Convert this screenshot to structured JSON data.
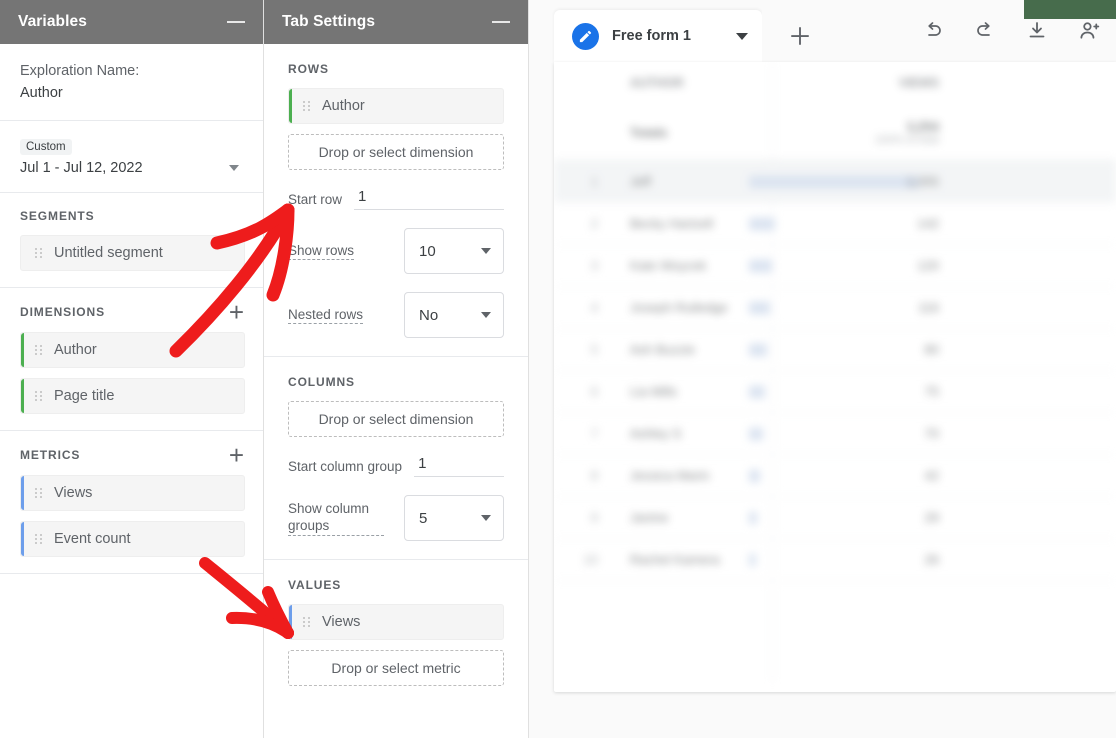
{
  "variables_panel": {
    "header_title": "Variables",
    "minimize_icon": "minimize-icon",
    "exploration_label": "Exploration Name:",
    "exploration_value": "Author",
    "date_chip": "Custom",
    "date_range": "Jul 1 - Jul 12, 2022",
    "segments": {
      "heading": "SEGMENTS",
      "items": [
        {
          "label": "Untitled segment",
          "bar": "none"
        }
      ]
    },
    "dimensions": {
      "heading": "DIMENSIONS",
      "add_label": "+",
      "items": [
        {
          "label": "Author",
          "bar": "green"
        },
        {
          "label": "Page title",
          "bar": "green"
        }
      ]
    },
    "metrics": {
      "heading": "METRICS",
      "add_label": "+",
      "items": [
        {
          "label": "Views",
          "bar": "blue"
        },
        {
          "label": "Event count",
          "bar": "blue"
        }
      ]
    }
  },
  "tab_settings_panel": {
    "header_title": "Tab Settings",
    "minimize_icon": "minimize-icon",
    "rows": {
      "heading": "ROWS",
      "items": [
        {
          "label": "Author",
          "bar": "green"
        }
      ],
      "dropzone": "Drop or select dimension",
      "start_row_label": "Start row",
      "start_row_value": "1",
      "show_rows_label": "Show rows",
      "show_rows_value": "10",
      "nested_rows_label": "Nested rows",
      "nested_rows_value": "No"
    },
    "columns": {
      "heading": "COLUMNS",
      "dropzone": "Drop or select dimension",
      "start_group_label": "Start column group",
      "start_group_value": "1",
      "show_groups_label": "Show column groups",
      "show_groups_value": "5"
    },
    "values": {
      "heading": "VALUES",
      "items": [
        {
          "label": "Views",
          "bar": "blue"
        }
      ],
      "dropzone": "Drop or select metric"
    }
  },
  "canvas": {
    "tab": {
      "label": "Free form 1",
      "icon": "pencil-icon",
      "caret_icon": "chevron-down-icon"
    },
    "add_tab_icon": "plus-icon",
    "toolbar": [
      {
        "name": "undo-icon"
      },
      {
        "name": "redo-icon"
      },
      {
        "name": "download-icon"
      },
      {
        "name": "share-add-user-icon"
      }
    ],
    "table": {
      "header": {
        "dimension": "AUTHOR",
        "metric": "VIEWS"
      },
      "totals": {
        "label": "Totals",
        "value": "3,254",
        "sub": "100% of total"
      },
      "rows": [
        {
          "idx": "1",
          "name": "Jeff",
          "value": "1,055",
          "bar_pct": 100
        },
        {
          "idx": "2",
          "name": "Becky Hartzell",
          "value": "142",
          "bar_pct": 14
        },
        {
          "idx": "3",
          "name": "Kate Woycek",
          "value": "120",
          "bar_pct": 12
        },
        {
          "idx": "4",
          "name": "Joseph Rutledge",
          "value": "116",
          "bar_pct": 11
        },
        {
          "idx": "5",
          "name": "Ash Buzzie",
          "value": "80",
          "bar_pct": 8
        },
        {
          "idx": "6",
          "name": "Lia Mills",
          "value": "75",
          "bar_pct": 7
        },
        {
          "idx": "7",
          "name": "Ashley S",
          "value": "70",
          "bar_pct": 6.5
        },
        {
          "idx": "8",
          "name": "Jessica Marin",
          "value": "42",
          "bar_pct": 4
        },
        {
          "idx": "9",
          "name": "Janine",
          "value": "29",
          "bar_pct": 2.5
        },
        {
          "idx": "10",
          "name": "Rachel Kamera",
          "value": "26",
          "bar_pct": 2
        }
      ]
    }
  },
  "annotations": {
    "arrow_top": "red-arrow-pointing-to-rows-section",
    "arrow_bottom": "red-arrow-pointing-to-values-section",
    "color": "#ee1c1c"
  },
  "overlay": {
    "green_block": "#476c4c"
  }
}
